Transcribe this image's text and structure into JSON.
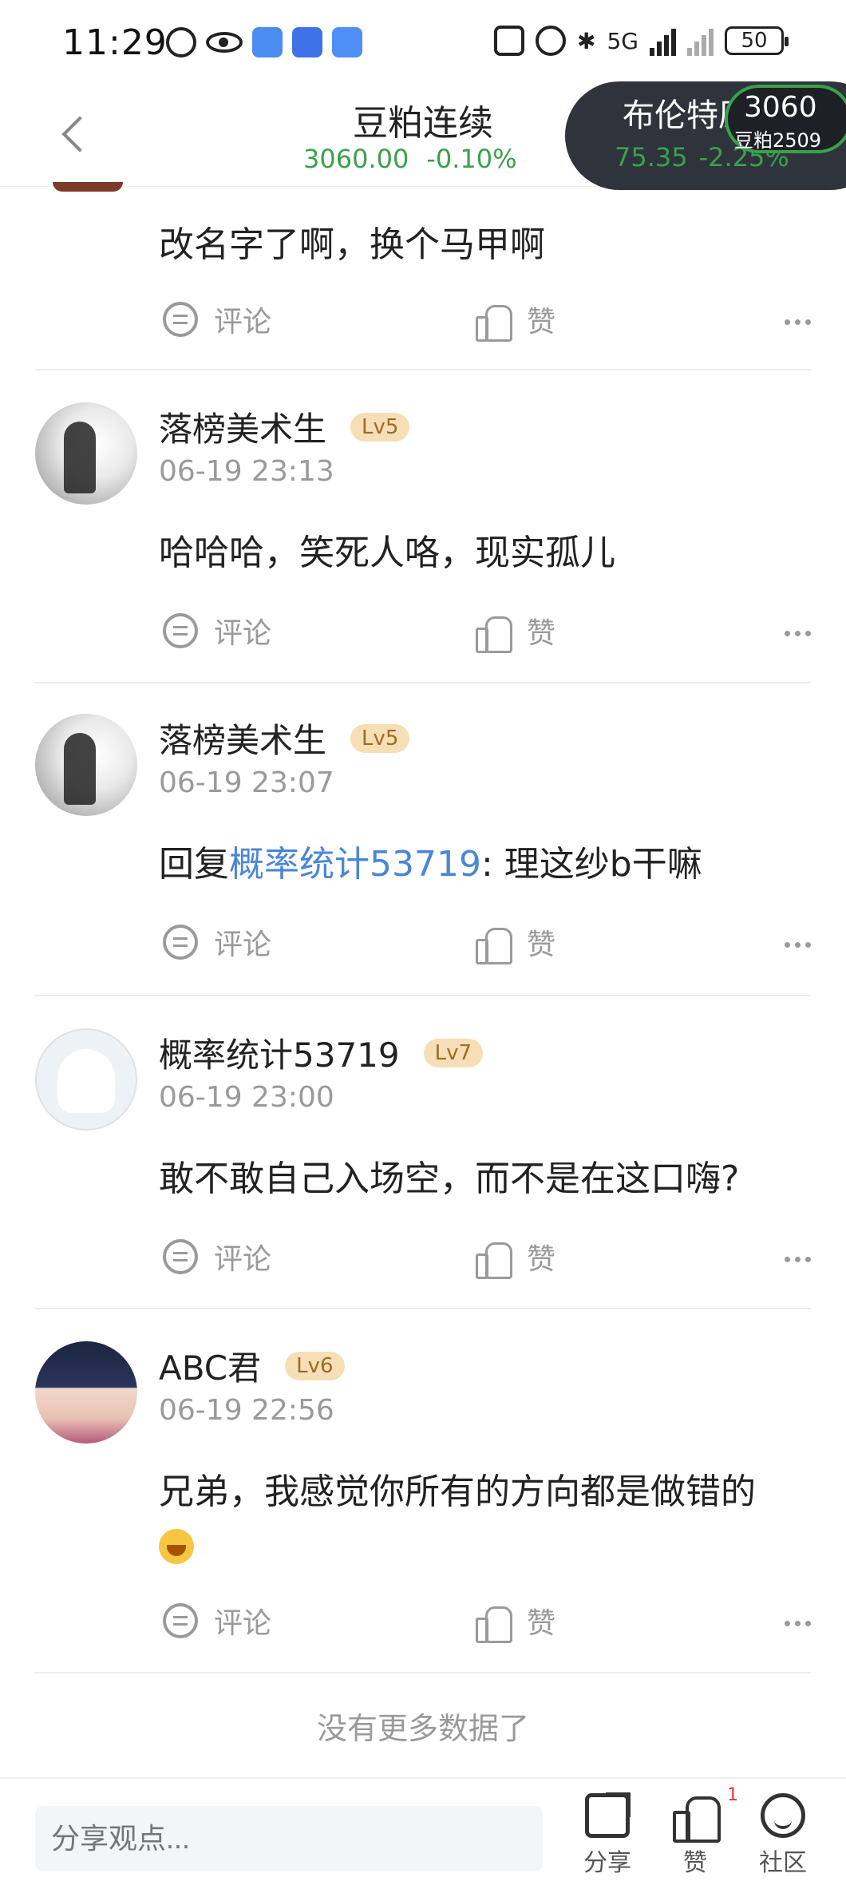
{
  "status_bar": {
    "time": "11:29",
    "network": "5G",
    "battery": "50"
  },
  "header": {
    "title": "豆粕连续",
    "price": "3060.00",
    "change": "-0.10%",
    "floating_pill": {
      "title": "布伦特原油",
      "price": "75.35",
      "change": "-2.25%",
      "mini_price": "3060",
      "mini_name": "豆粕2509"
    },
    "accent_color": "#3aa14b"
  },
  "partial_post": {
    "content": "改名字了啊，换个马甲啊",
    "comment_label": "评论",
    "like_label": "赞"
  },
  "posts": [
    {
      "name": "落榜美术生",
      "level": "Lv5",
      "time": "06-19 23:13",
      "content": "哈哈哈，笑死人咯，现实孤儿",
      "comment_label": "评论",
      "like_label": "赞"
    },
    {
      "name": "落榜美术生",
      "level": "Lv5",
      "time": "06-19 23:07",
      "reply_prefix": "回复",
      "reply_to": "概率统计53719",
      "content": ": 理这纱b干嘛",
      "comment_label": "评论",
      "like_label": "赞"
    },
    {
      "name": "概率统计53719",
      "level": "Lv7",
      "time": "06-19 23:00",
      "content": "敢不敢自己入场空，而不是在这口嗨?",
      "comment_label": "评论",
      "like_label": "赞"
    },
    {
      "name": "ABC君",
      "level": "Lv6",
      "time": "06-19 22:56",
      "content": "兄弟，我感觉你所有的方向都是做错的",
      "comment_label": "评论",
      "like_label": "赞"
    }
  ],
  "footer_note": "没有更多数据了",
  "bottom_bar": {
    "input_placeholder": "分享观点...",
    "share_label": "分享",
    "like_label": "赞",
    "like_count": "1",
    "community_label": "社区"
  }
}
